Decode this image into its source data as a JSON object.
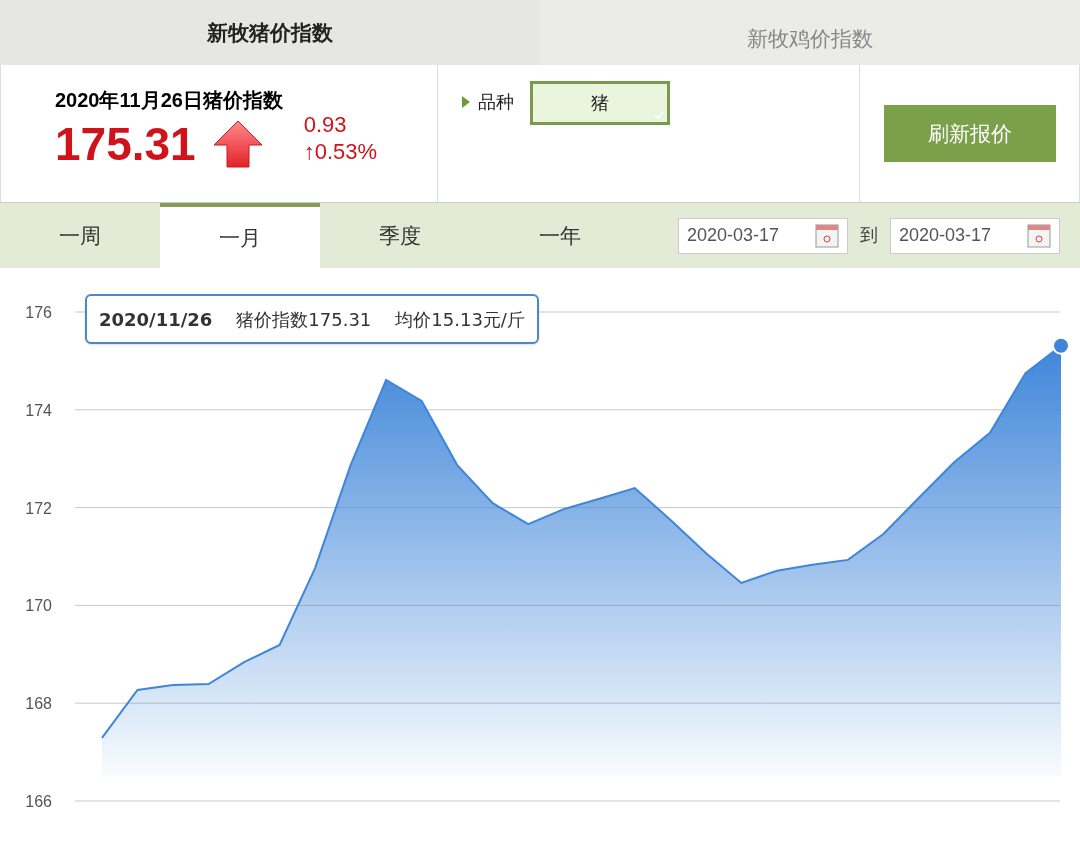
{
  "top_tabs": [
    {
      "label": "新牧猪价指数",
      "selected": true
    },
    {
      "label": "新牧鸡价指数",
      "selected": false
    }
  ],
  "index_panel": {
    "title": "2020年11月26日猪价指数",
    "value": "175.31",
    "rising": true,
    "change": "0.93",
    "change_pct": "↑0.53%"
  },
  "variety": {
    "label": "品种",
    "value": "猪"
  },
  "refresh_button": "刷新报价",
  "period_tabs": [
    {
      "label": "一周",
      "selected": false
    },
    {
      "label": "一月",
      "selected": true
    },
    {
      "label": "季度",
      "selected": false
    },
    {
      "label": "一年",
      "selected": false
    }
  ],
  "date_range": {
    "from": "2020-03-17",
    "separator": "到",
    "to": "2020-03-17"
  },
  "chart": {
    "tooltip": {
      "date": "2020/11/26",
      "index": "猪价指数175.31",
      "price": "均价15.13元/斤"
    },
    "chart_data": {
      "type": "area",
      "grid": true,
      "ylim": [
        166,
        176
      ],
      "yticks": [
        166,
        168,
        170,
        172,
        174,
        176
      ],
      "series": [
        {
          "color": "#3f86d9",
          "values": [
            167.29,
            168.27,
            168.37,
            168.39,
            168.84,
            169.19,
            170.76,
            172.87,
            174.61,
            174.18,
            172.87,
            172.09,
            171.66,
            171.97,
            172.18,
            172.4,
            171.75,
            171.07,
            170.46,
            170.71,
            170.83,
            170.93,
            171.46,
            172.2,
            172.93,
            173.53,
            174.75,
            175.31
          ]
        }
      ]
    }
  }
}
